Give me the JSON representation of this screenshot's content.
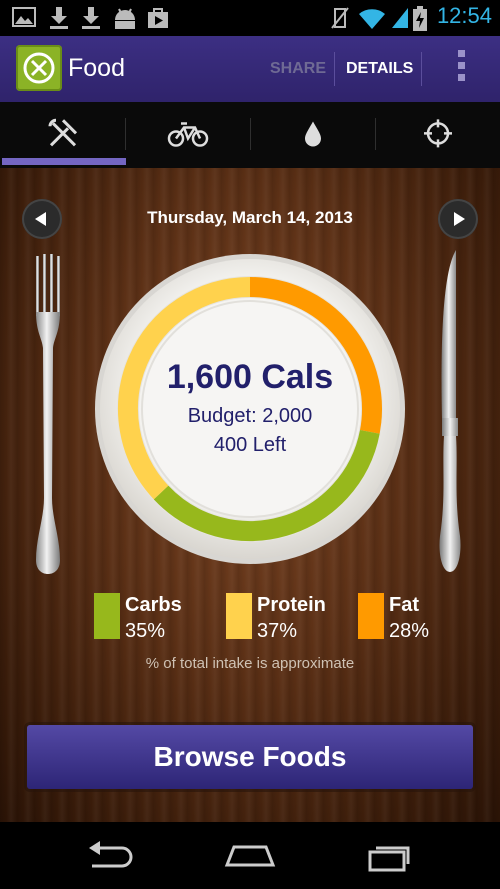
{
  "status_bar": {
    "time": "12:54"
  },
  "action_bar": {
    "title": "Food",
    "share_label": "SHARE",
    "details_label": "DETAILS"
  },
  "tabs": [
    {
      "name": "food",
      "icon": "fork-knife-icon",
      "selected": true
    },
    {
      "name": "exercise",
      "icon": "bicycle-icon",
      "selected": false
    },
    {
      "name": "water",
      "icon": "water-drop-icon",
      "selected": false
    },
    {
      "name": "goals",
      "icon": "target-icon",
      "selected": false
    }
  ],
  "date_nav": {
    "date": "Thursday, March 14, 2013"
  },
  "summary": {
    "calories": "1,600 Cals",
    "budget": "Budget: 2,000",
    "left": "400 Left"
  },
  "macros": [
    {
      "name": "Carbs",
      "percent": "35%",
      "color": "#97b81c"
    },
    {
      "name": "Protein",
      "percent": "37%",
      "color": "#ffd24d"
    },
    {
      "name": "Fat",
      "percent": "28%",
      "color": "#ff9a00"
    }
  ],
  "note": "% of total intake is approximate",
  "browse_button": "Browse Foods",
  "colors": {
    "accent": "#7466c2",
    "action_bar": "#35297a",
    "button": "#3d3390"
  }
}
